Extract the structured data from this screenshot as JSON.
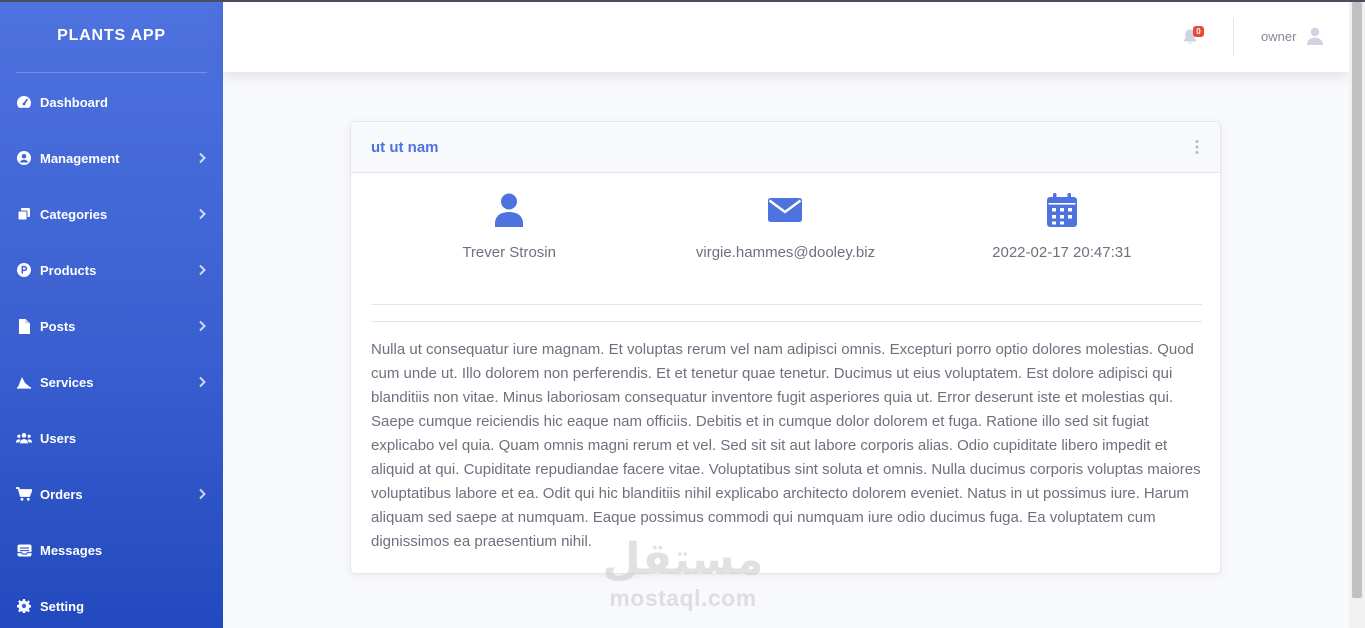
{
  "sidebar": {
    "brand": "PLANTS APP",
    "items": [
      {
        "label": "Dashboard",
        "icon": "tachometer-icon",
        "has_submenu": false
      },
      {
        "label": "Management",
        "icon": "user-circle-icon",
        "has_submenu": true
      },
      {
        "label": "Categories",
        "icon": "copy-icon",
        "has_submenu": true
      },
      {
        "label": "Products",
        "icon": "product-coin-icon",
        "has_submenu": true
      },
      {
        "label": "Posts",
        "icon": "file-icon",
        "has_submenu": true
      },
      {
        "label": "Services",
        "icon": "services-icon",
        "has_submenu": true
      },
      {
        "label": "Users",
        "icon": "users-icon",
        "has_submenu": false
      },
      {
        "label": "Orders",
        "icon": "cart-icon",
        "has_submenu": true
      },
      {
        "label": "Messages",
        "icon": "inbox-icon",
        "has_submenu": false
      },
      {
        "label": "Setting",
        "icon": "gear-icon",
        "has_submenu": false
      }
    ]
  },
  "topbar": {
    "notifications_count": "0",
    "username": "owner"
  },
  "card": {
    "title": "ut ut nam",
    "name": "Trever Strosin",
    "email": "virgie.hammes@dooley.biz",
    "date": "2022-02-17 20:47:31",
    "description": "Nulla ut consequatur iure magnam. Et voluptas rerum vel nam adipisci omnis. Excepturi porro optio dolores molestias. Quod cum unde ut. Illo dolorem non perferendis. Et et tenetur quae tenetur. Ducimus ut eius voluptatem. Est dolore adipisci qui blanditiis non vitae. Minus laboriosam consequatur inventore fugit asperiores quia ut. Error deserunt iste et molestias qui. Saepe cumque reiciendis hic eaque nam officiis. Debitis et in cumque dolor dolorem et fuga. Ratione illo sed sit fugiat explicabo vel quia. Quam omnis magni rerum et vel. Sed sit sit aut labore corporis alias. Odio cupiditate libero impedit et aliquid at qui. Cupiditate repudiandae facere vitae. Voluptatibus sint soluta et omnis. Nulla ducimus corporis voluptas maiores voluptatibus labore et ea. Odit qui hic blanditiis nihil explicabo architecto dolorem eveniet. Natus in ut possimus iure. Harum aliquam sed saepe at numquam. Eaque possimus commodi qui numquam iure odio ducimus fuga. Ea voluptatem cum dignissimos ea praesentium nihil."
  },
  "watermark": {
    "arabic": "مستقل",
    "latin": "mostaql.com"
  },
  "colors": {
    "primary": "#4e73df",
    "sidebar_bottom": "#224abe",
    "badge": "#e74a3b",
    "text_muted": "#6e707e"
  }
}
